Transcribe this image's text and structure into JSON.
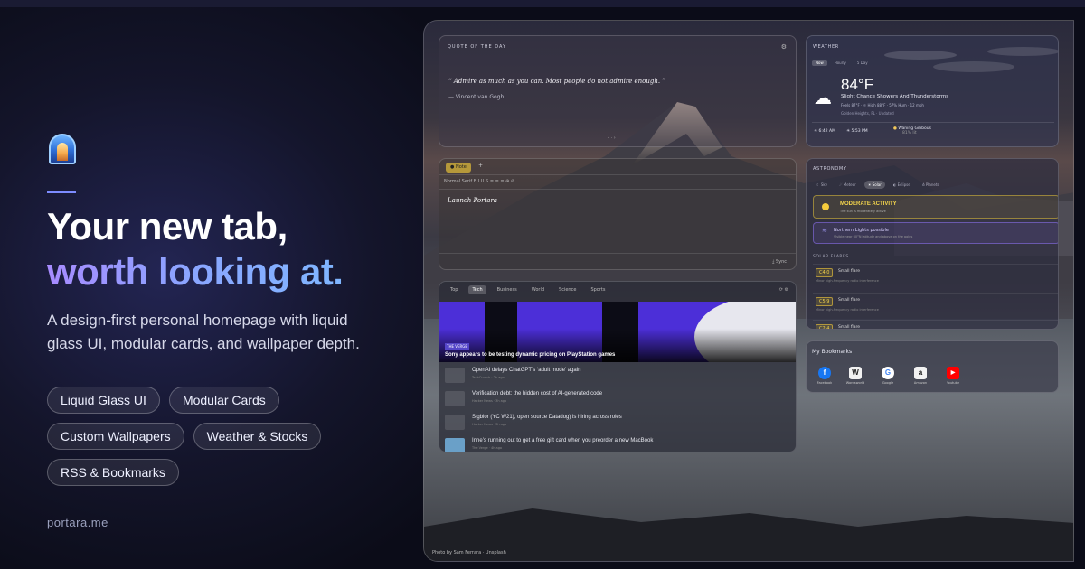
{
  "hero": {
    "headline_line1": "Your new tab,",
    "headline_line2": "worth looking at.",
    "subtext": "A design-first personal homepage with liquid glass UI, modular cards, and wallpaper depth.",
    "pills": [
      "Liquid Glass UI",
      "Modular Cards",
      "Custom Wallpapers",
      "Weather & Stocks",
      "RSS & Bookmarks"
    ],
    "domain": "portara.me"
  },
  "screen": {
    "photo_credit": "Photo by Sam Ferrara · Unsplash",
    "quote_card": {
      "title": "QUOTE OF THE DAY",
      "quote": "“ Admire as much as you can. Most people do not admire enough. ”",
      "author": "— Vincent van Gogh",
      "nav": "‹ · ›"
    },
    "note_card": {
      "tab_label": "● Note",
      "add": "+",
      "toolbar": "Normal   Serif   B  I  U  S   ≡  ≡  ≡   ⊕  ⊘",
      "body": "Launch Portara",
      "sync": "⤓ Sync"
    },
    "news_card": {
      "tabs": [
        "Top",
        "Tech",
        "Business",
        "World",
        "Science",
        "Sports"
      ],
      "active_tab": "Tech",
      "controls": "⟳   ⚙",
      "hero_source": "THE VERGE",
      "hero_title": "Sony appears to be testing dynamic pricing on PlayStation games",
      "items": [
        {
          "title": "OpenAI delays ChatGPT’s ‘adult mode’ again",
          "meta": "TechCrunch · 2h ago"
        },
        {
          "title": "Verification debt: the hidden cost of AI-generated code",
          "meta": "Hacker News · 3h ago"
        },
        {
          "title": "Sigblor (YC W21), open source Datadog) is hiring across roles",
          "meta": "Hacker News · 3h ago"
        },
        {
          "title": "Inne’s running out to get a free gift card when you preorder a new MacBook",
          "meta": "The Verge · 4h ago"
        }
      ]
    },
    "weather_card": {
      "title": "WEATHER",
      "tabs": [
        "Now",
        "Hourly",
        "5 Day"
      ],
      "active_tab": "Now",
      "temp": "84°F",
      "condition": "Slight Chance Showers And Thunderstorms",
      "details": "Feels 87°F  ·  ☼ High 88°F  ·  57% Hum  ·  12 mph",
      "location": "Golden Heights, FL  ·  Updated",
      "sunrise": "6:42 AM",
      "sunset": "5:53 PM",
      "moon_phase": "Waning Gibbous",
      "moon_illum": "81% lit"
    },
    "astro_card": {
      "title": "ASTRONOMY",
      "tabs": [
        "☾ Sky",
        "☄ Meteor",
        "☀ Solar",
        "◐ Eclipse",
        "♁ Planets"
      ],
      "active_tab": "☀ Solar",
      "alert_title": "MODERATE ACTIVITY",
      "alert_sub": "The sun is moderately active",
      "aurora_title": "Northern Lights possible",
      "aurora_sub": "Visible near 60°N latitude and above on the poles",
      "section": "SOLAR FLARES",
      "flares": [
        {
          "class": "C4.0",
          "name": "Small flare",
          "desc": "Minor high-frequency radio interference"
        },
        {
          "class": "C5.9",
          "name": "Small flare",
          "desc": "Minor high-frequency radio interference"
        },
        {
          "class": "C2.4",
          "name": "Small flare",
          "desc": ""
        }
      ]
    },
    "bookmarks_card": {
      "title": "My Bookmarks",
      "items": [
        {
          "label": "Facebook",
          "glyph": "f",
          "color": "#1877f2"
        },
        {
          "label": "Wordsworld",
          "glyph": "W",
          "color": "#222"
        },
        {
          "label": "Google",
          "glyph": "G",
          "color": "#4285f4"
        },
        {
          "label": "Amazon",
          "glyph": "a",
          "color": "#111"
        },
        {
          "label": "Youtube",
          "glyph": "▶",
          "color": "#ff0000"
        }
      ]
    }
  }
}
